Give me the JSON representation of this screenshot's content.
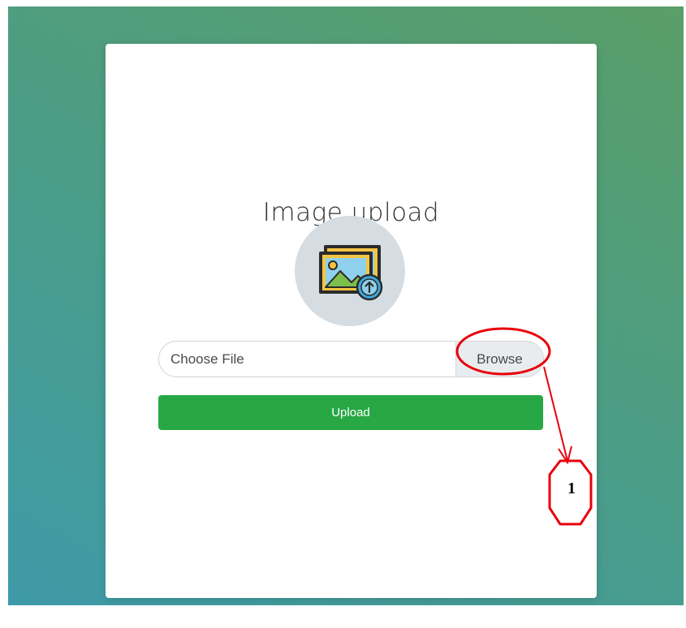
{
  "card": {
    "title": "Image upload",
    "icon": "image-upload-icon"
  },
  "file_input": {
    "placeholder": "Choose File",
    "browse_label": "Browse"
  },
  "upload_button": {
    "label": "Upload"
  },
  "annotation": {
    "marker_label": "1",
    "color": "#e8000b"
  },
  "colors": {
    "upload_button": "#28a745",
    "background_gradient_start": "#3e9aa8",
    "background_gradient_end": "#5a9e68"
  }
}
